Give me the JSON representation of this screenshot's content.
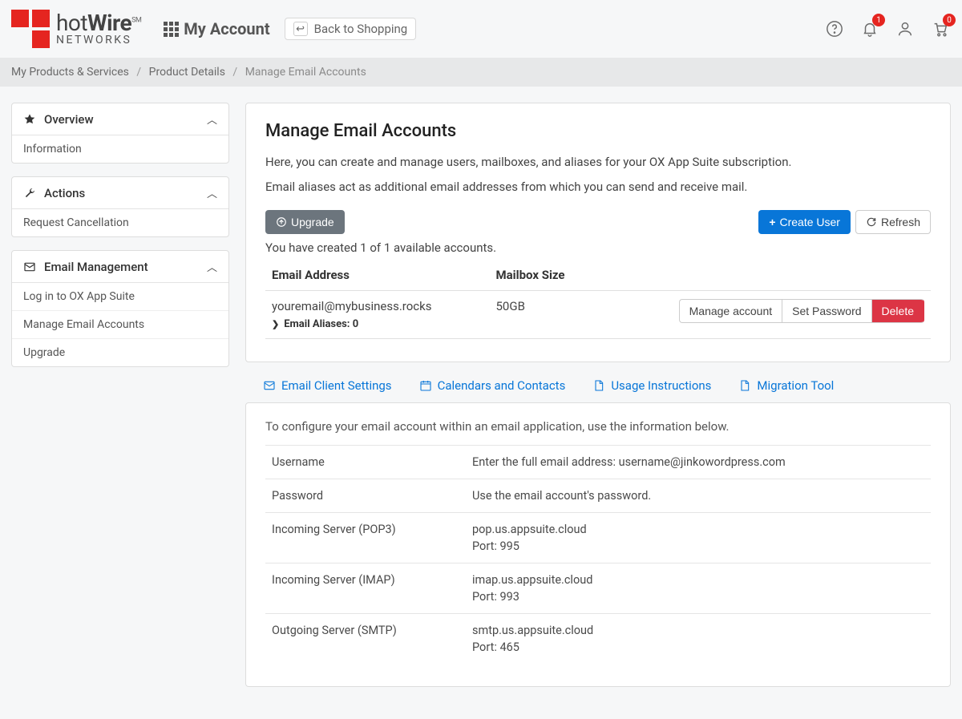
{
  "header": {
    "my_account": "My Account",
    "back": "Back to Shopping",
    "badges": {
      "bell": "1",
      "cart": "0"
    }
  },
  "breadcrumb": {
    "a": "My Products & Services",
    "b": "Product Details",
    "c": "Manage Email Accounts"
  },
  "sidebar": {
    "overview": {
      "title": "Overview",
      "items": {
        "info": "Information"
      }
    },
    "actions": {
      "title": "Actions",
      "items": {
        "cancel": "Request Cancellation"
      }
    },
    "email": {
      "title": "Email Management",
      "items": {
        "login": "Log in to OX App Suite",
        "manage": "Manage Email Accounts",
        "upgrade": "Upgrade"
      }
    }
  },
  "page": {
    "title": "Manage Email Accounts",
    "desc1": "Here, you can create and manage users, mailboxes, and aliases for your OX App Suite subscription.",
    "desc2": "Email aliases act as additional email addresses from which you can send and receive mail.",
    "upgrade_btn": "Upgrade",
    "create_btn": "Create User",
    "refresh_btn": "Refresh",
    "count": "You have created 1 of 1 available accounts.",
    "th_email": "Email Address",
    "th_size": "Mailbox Size",
    "row": {
      "email": "youremail@mybusiness.rocks",
      "size": "50GB",
      "aliases": "Email Aliases: 0",
      "manage": "Manage account",
      "setpw": "Set Password",
      "delete": "Delete"
    }
  },
  "tabs": {
    "a": "Email Client Settings",
    "b": "Calendars and Contacts",
    "c": "Usage Instructions",
    "d": "Migration Tool"
  },
  "settings": {
    "intro": "To configure your email account within an email application, use the information below.",
    "rows": {
      "user_l": "Username",
      "user_v": "Enter the full email address: username@jinkowordpress.com",
      "pass_l": "Password",
      "pass_v": "Use the email account's password.",
      "pop_l": "Incoming Server (POP3)",
      "pop_v": "pop.us.appsuite.cloud",
      "pop_p": "Port: 995",
      "imap_l": "Incoming Server (IMAP)",
      "imap_v": "imap.us.appsuite.cloud",
      "imap_p": "Port: 993",
      "smtp_l": "Outgoing Server (SMTP)",
      "smtp_v": "smtp.us.appsuite.cloud",
      "smtp_p": "Port: 465"
    }
  }
}
